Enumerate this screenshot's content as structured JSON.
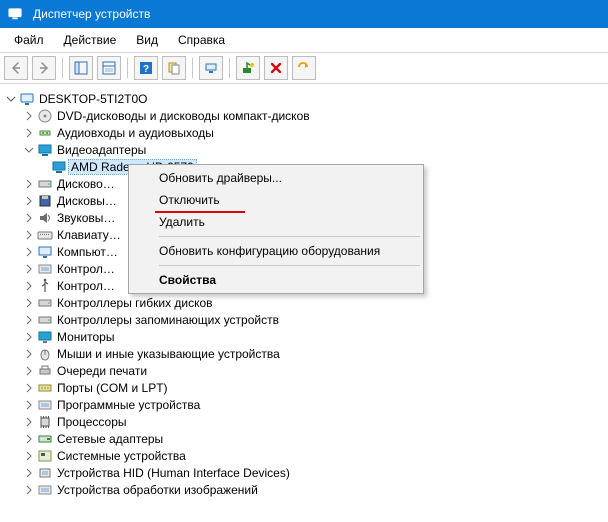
{
  "titlebar": {
    "title": "Диспетчер устройств"
  },
  "menubar": {
    "items": [
      "Файл",
      "Действие",
      "Вид",
      "Справка"
    ]
  },
  "tree": {
    "root": {
      "label": "DESKTOP-5TI2T0O",
      "expanded": true
    },
    "children": [
      {
        "label": "DVD-дисководы и дисководы компакт-дисков",
        "icon": "disc-icon",
        "expanded": false
      },
      {
        "label": "Аудиовходы и аудиовыходы",
        "icon": "audio-jack-icon",
        "expanded": false
      },
      {
        "label": "Видеоадаптеры",
        "icon": "display-adapter-icon",
        "expanded": true,
        "children": [
          {
            "label": "AMD Radeon HD 6570",
            "icon": "display-adapter-icon",
            "selected": true
          }
        ]
      },
      {
        "label": "Дисково…",
        "icon": "drive-icon",
        "expanded": false
      },
      {
        "label": "Дисковы…",
        "icon": "floppy-icon",
        "expanded": false
      },
      {
        "label": "Звуковы…",
        "icon": "sound-icon",
        "expanded": false
      },
      {
        "label": "Клавиату…",
        "icon": "keyboard-icon",
        "expanded": false
      },
      {
        "label": "Компьют…",
        "icon": "computer-icon",
        "expanded": false
      },
      {
        "label": "Контрол…",
        "icon": "controller-icon",
        "expanded": false
      },
      {
        "label": "Контрол…",
        "icon": "usb-icon",
        "expanded": false
      },
      {
        "label": "Контроллеры гибких дисков",
        "icon": "floppy-controller-icon",
        "expanded": false
      },
      {
        "label": "Контроллеры запоминающих устройств",
        "icon": "storage-controller-icon",
        "expanded": false
      },
      {
        "label": "Мониторы",
        "icon": "monitor-icon",
        "expanded": false
      },
      {
        "label": "Мыши и иные указывающие устройства",
        "icon": "mouse-icon",
        "expanded": false
      },
      {
        "label": "Очереди печати",
        "icon": "printer-icon",
        "expanded": false
      },
      {
        "label": "Порты (COM и LPT)",
        "icon": "port-icon",
        "expanded": false
      },
      {
        "label": "Программные устройства",
        "icon": "software-device-icon",
        "expanded": false
      },
      {
        "label": "Процессоры",
        "icon": "cpu-icon",
        "expanded": false
      },
      {
        "label": "Сетевые адаптеры",
        "icon": "network-adapter-icon",
        "expanded": false
      },
      {
        "label": "Системные устройства",
        "icon": "system-device-icon",
        "expanded": false
      },
      {
        "label": "Устройства HID (Human Interface Devices)",
        "icon": "hid-icon",
        "expanded": false
      },
      {
        "label": "Устройства обработки изображений",
        "icon": "imaging-icon",
        "expanded": false
      }
    ]
  },
  "context_menu": {
    "items": [
      {
        "label": "Обновить драйверы...",
        "key": "update-drivers"
      },
      {
        "label": "Отключить",
        "key": "disable",
        "highlight": true
      },
      {
        "label": "Удалить",
        "key": "uninstall"
      },
      {
        "sep": true
      },
      {
        "label": "Обновить конфигурацию оборудования",
        "key": "scan-hardware"
      },
      {
        "sep": true
      },
      {
        "label": "Свойства",
        "key": "properties",
        "bold": true
      }
    ]
  },
  "colors": {
    "accent": "#0a78d5",
    "highlight_red": "#d40b0b",
    "selection": "#cde8ff"
  }
}
